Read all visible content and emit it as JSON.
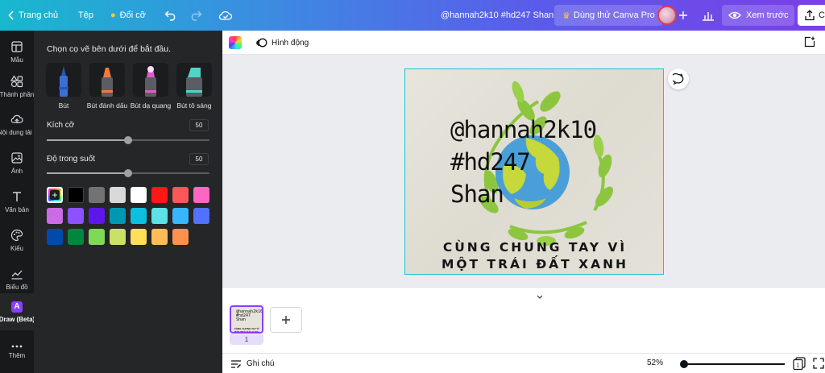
{
  "topbar": {
    "home_label": "Trang chủ",
    "file_label": "Tệp",
    "resize_label": "Đổi cỡ",
    "doc_title": "@hannah2k10 #hd247 Shan",
    "pro_label": "Dùng thử Canva Pro",
    "view_label": "Xem trước",
    "share_label": "C"
  },
  "rail": {
    "items": [
      {
        "label": "Mẫu",
        "icon": "template-icon"
      },
      {
        "label": "Thành phần",
        "icon": "elements-icon"
      },
      {
        "label": "Nội dung tải lên",
        "icon": "upload-icon"
      },
      {
        "label": "Ảnh",
        "icon": "photo-icon"
      },
      {
        "label": "Văn bản",
        "icon": "text-icon"
      },
      {
        "label": "Kiểu",
        "icon": "palette-icon"
      },
      {
        "label": "Biểu đồ",
        "icon": "chart-icon"
      },
      {
        "label": "Draw (Beta)",
        "icon": "draw-icon"
      },
      {
        "label": "Thêm",
        "icon": "more-icon"
      }
    ]
  },
  "panel": {
    "hint": "Chọn cọ vẽ bên dưới để bắt đầu.",
    "brushes": [
      {
        "label": "Bút",
        "color": "#3b6fd8"
      },
      {
        "label": "Bút đánh dấu",
        "color": "#f07a3c"
      },
      {
        "label": "Bút dạ quang",
        "color": "#e05ad0"
      },
      {
        "label": "Bút tô sáng",
        "color": "#4fd6c8"
      }
    ],
    "size": {
      "label": "Kích cỡ",
      "value": "50",
      "fraction": 0.5
    },
    "opacity": {
      "label": "Độ trong suốt",
      "value": "50",
      "fraction": 0.5
    },
    "swatches": [
      "#000000",
      "#737373",
      "#d9d9d9",
      "#ffffff",
      "#ff1616",
      "#ff5757",
      "#ff66c4",
      "#cb6ce6",
      "#8c52ff",
      "#5e17eb",
      "#0097b2",
      "#0cc0df",
      "#5ce1e6",
      "#38b6ff",
      "#5271ff",
      "#004aad",
      "#00873e",
      "#7ed957",
      "#c9e265",
      "#ffde59",
      "#ffbd59",
      "#ff914d"
    ]
  },
  "toolbar": {
    "animate_label": "Hình động"
  },
  "design": {
    "line1": "@hannah2k10",
    "line2": "#hd247",
    "line3": "Shan",
    "slogan1": "CÙNG CHUNG TAY VÌ",
    "slogan2": "MỘT TRÁI ĐẤT XANH"
  },
  "pages": {
    "current_page": "1",
    "thumb_line1": "@hannah2k10",
    "thumb_line2": "#hd247",
    "thumb_line3": "Shan",
    "thumb_slogan": "CÙNG CHUNG TAY VÌ MỘT TRÁI ĐẤT XANH"
  },
  "bottombar": {
    "notes_label": "Ghi chú",
    "zoom_label": "52%",
    "page_count": "1"
  }
}
